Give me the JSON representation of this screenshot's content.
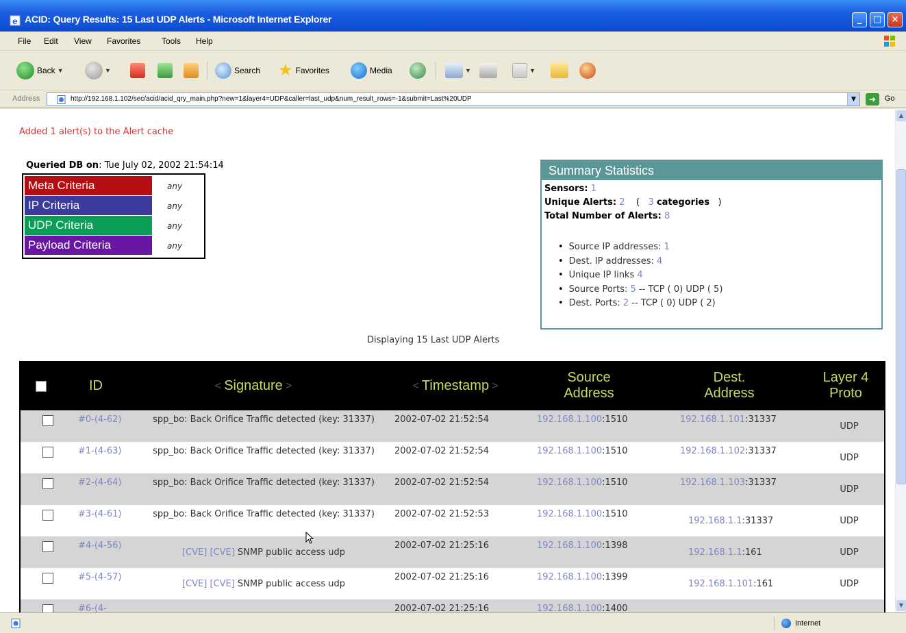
{
  "window": {
    "title": "ACID: Query Results: 15 Last UDP Alerts - Microsoft Internet Explorer"
  },
  "menu": [
    "File",
    "Edit",
    "View",
    "Favorites",
    "Tools",
    "Help"
  ],
  "toolbar": {
    "back": "Back",
    "search": "Search",
    "favorites": "Favorites",
    "media": "Media"
  },
  "address": {
    "label": "Address",
    "url": "http://192.168.1.102/sec/acid/acid_qry_main.php?new=1&layer4=UDP&caller=last_udp&num_result_rows=-1&submit=Last%20UDP",
    "go": "Go"
  },
  "page": {
    "cache_message": "Added 1 alert(s) to the Alert cache",
    "queried_label": "Queried DB on",
    "queried_value": ": Tue July 02, 2002 21:54:14",
    "criteria": [
      {
        "label": "Meta Criteria",
        "value": "any",
        "color": "#b40d12"
      },
      {
        "label": "IP Criteria",
        "value": "any",
        "color": "#3b3a9d"
      },
      {
        "label": "UDP Criteria",
        "value": "any",
        "color": "#0c9e58"
      },
      {
        "label": "Payload Criteria",
        "value": "any",
        "color": "#6a16a5"
      }
    ],
    "summary": {
      "title": "Summary Statistics",
      "sensors_label": "Sensors:",
      "sensors_value": "1",
      "unique_label": "Unique Alerts:",
      "unique_value": "2",
      "open_paren": "(",
      "categories_count": "3",
      "categories_label": "categories",
      "close_paren": ")",
      "total_label": "Total Number of Alerts:",
      "total_value": "8",
      "items": [
        {
          "label": "Source IP addresses: ",
          "value": "1",
          "rest": ""
        },
        {
          "label": "Dest. IP addresses: ",
          "value": "4",
          "rest": ""
        },
        {
          "label": "Unique IP links ",
          "value": "4",
          "rest": ""
        },
        {
          "label": "Source Ports: ",
          "value": "5",
          "rest": " -- TCP ( 0) UDP ( 5)"
        },
        {
          "label": "Dest. Ports: ",
          "value": "2",
          "rest": " -- TCP ( 0) UDP ( 2)"
        }
      ]
    },
    "displaying": "Displaying 15 Last UDP Alerts",
    "columns": {
      "id": "ID",
      "signature": "Signature",
      "timestamp": "Timestamp",
      "source": "Source Address",
      "dest": "Dest. Address",
      "proto": "Layer 4 Proto"
    },
    "rows": [
      {
        "id": "#0-(4-62)",
        "sig_prefix": "",
        "sig": "spp_bo: Back Orifice Traffic detected (key: 31337)",
        "ts": "2002-07-02 21:52:54",
        "src_ip": "192.168.1.100",
        "src_port": ":1510",
        "dst_ip": "192.168.1.101",
        "dst_port": ":31337",
        "proto": "UDP"
      },
      {
        "id": "#1-(4-63)",
        "sig_prefix": "",
        "sig": "spp_bo: Back Orifice Traffic detected (key: 31337)",
        "ts": "2002-07-02 21:52:54",
        "src_ip": "192.168.1.100",
        "src_port": ":1510",
        "dst_ip": "192.168.1.102",
        "dst_port": ":31337",
        "proto": "UDP"
      },
      {
        "id": "#2-(4-64)",
        "sig_prefix": "",
        "sig": "spp_bo: Back Orifice Traffic detected (key: 31337)",
        "ts": "2002-07-02 21:52:54",
        "src_ip": "192.168.1.100",
        "src_port": ":1510",
        "dst_ip": "192.168.1.103",
        "dst_port": ":31337",
        "proto": "UDP"
      },
      {
        "id": "#3-(4-61)",
        "sig_prefix": "",
        "sig": "spp_bo: Back Orifice Traffic detected (key: 31337)",
        "ts": "2002-07-02 21:52:53",
        "src_ip": "192.168.1.100",
        "src_port": ":1510",
        "dst_ip": "192.168.1.1",
        "dst_port": ":31337",
        "proto": "UDP"
      },
      {
        "id": "#4-(4-56)",
        "sig_prefix": "[CVE] [CVE]",
        "sig": "SNMP public access udp",
        "ts": "2002-07-02 21:25:16",
        "src_ip": "192.168.1.100",
        "src_port": ":1398",
        "dst_ip": "192.168.1.1",
        "dst_port": ":161",
        "proto": "UDP"
      },
      {
        "id": "#5-(4-57)",
        "sig_prefix": "[CVE] [CVE]",
        "sig": "SNMP public access udp",
        "ts": "2002-07-02 21:25:16",
        "src_ip": "192.168.1.100",
        "src_port": ":1399",
        "dst_ip": "192.168.1.101",
        "dst_port": ":161",
        "proto": "UDP"
      },
      {
        "id": "#6-(4-",
        "sig_prefix": "",
        "sig": "",
        "ts": "2002-07-02 21:25:16",
        "src_ip": "192.168.1.100",
        "src_port": ":1400",
        "dst_ip": "",
        "dst_port": "",
        "proto": ""
      }
    ]
  },
  "status": {
    "zone": "Internet"
  }
}
